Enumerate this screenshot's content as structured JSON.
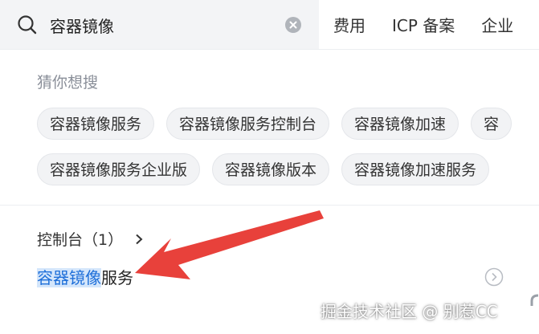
{
  "search": {
    "value": "容器镜像",
    "placeholder": ""
  },
  "nav": {
    "items": [
      "费用",
      "ICP 备案",
      "企业"
    ]
  },
  "suggestions": {
    "label": "猜你想搜",
    "row1": [
      "容器镜像服务",
      "容器镜像服务控制台",
      "容器镜像加速",
      "容"
    ],
    "row2": [
      "容器镜像服务企业版",
      "容器镜像版本",
      "容器镜像加速服务"
    ]
  },
  "results": {
    "category_label": "控制台（1）",
    "item_highlight": "容器镜像",
    "item_rest": "服务"
  },
  "watermark": "掘金技术社区 @ 别惹CC",
  "colors": {
    "accent": "#1e6fd9",
    "highlight_bg": "#d4e6fb",
    "annotation_red": "#e8413b"
  },
  "icons": [
    "search-icon",
    "clear-icon",
    "chevron-right-icon",
    "circle-chevron-right-icon"
  ]
}
